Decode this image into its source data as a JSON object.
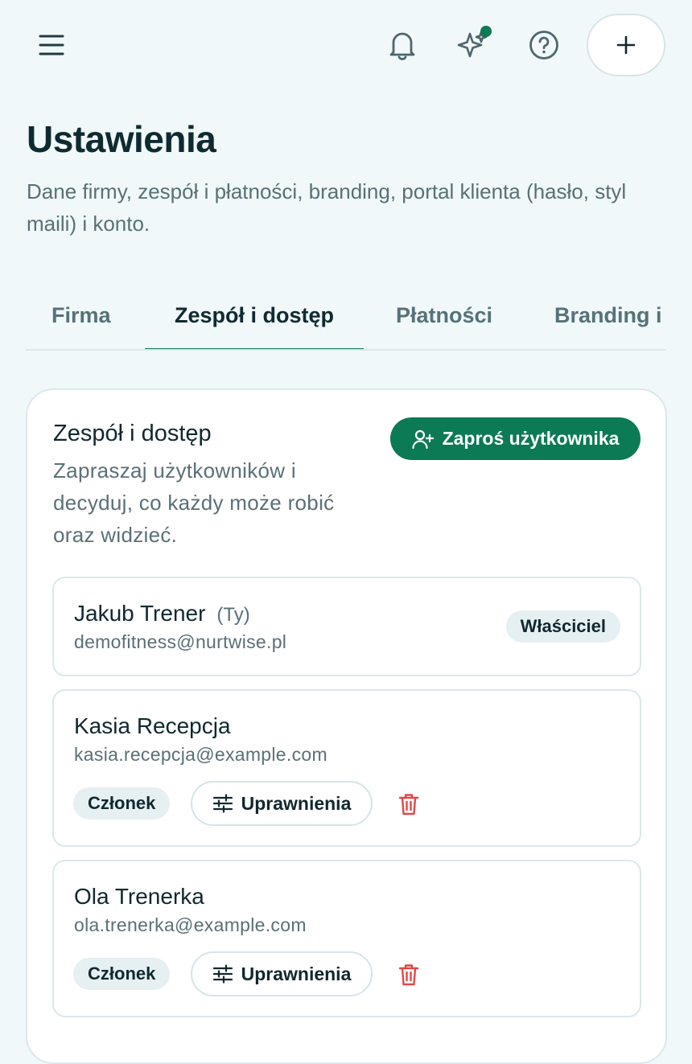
{
  "header": {
    "menu_icon": "menu-icon",
    "bell_icon": "bell-icon",
    "sparkle_icon": "sparkle-icon",
    "help_icon": "help-icon",
    "plus_icon": "plus-icon",
    "notification_dot_color": "#0c7a55"
  },
  "page": {
    "title": "Ustawienia",
    "subtitle": "Dane firmy, zespół i płatności, branding, portal klienta (hasło, styl maili) i konto."
  },
  "tabs": [
    {
      "label": "Firma",
      "active": false
    },
    {
      "label": "Zespół i dostęp",
      "active": true
    },
    {
      "label": "Płatności",
      "active": false
    },
    {
      "label": "Branding i",
      "active": false
    }
  ],
  "team": {
    "title": "Zespół i dostęp",
    "description": "Zapraszaj użytkowników i decyduj, co każdy może robić oraz widzieć.",
    "invite_label": "Zaproś użytkownika",
    "accent_color": "#0c7a55",
    "members": [
      {
        "name": "Jakub Trener",
        "you_label": "(Ty)",
        "email": "demofitness@nurtwise.pl",
        "role": "Właściciel"
      },
      {
        "name": "Kasia Recepcja",
        "email": "kasia.recepcja@example.com",
        "role": "Członek",
        "permissions_label": "Uprawnienia"
      },
      {
        "name": "Ola Trenerka",
        "email": "ola.trenerka@example.com",
        "role": "Członek",
        "permissions_label": "Uprawnienia"
      }
    ]
  }
}
